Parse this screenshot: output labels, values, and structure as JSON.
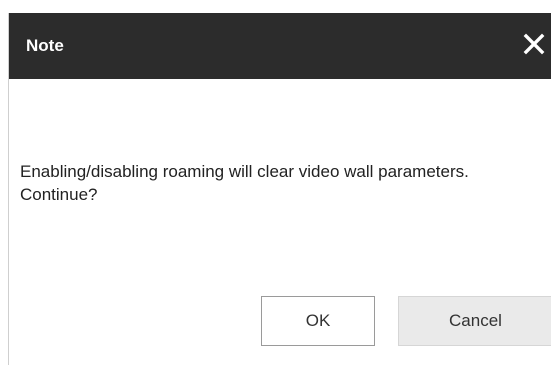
{
  "dialog": {
    "title": "Note",
    "close_icon": "close-icon",
    "message": "Enabling/disabling roaming will clear video wall parameters. Continue?",
    "ok_label": "OK",
    "cancel_label": "Cancel"
  },
  "colors": {
    "titlebar": "#2c2c2c",
    "title_text": "#ffffff",
    "cancel_bg": "#eaeaea"
  }
}
